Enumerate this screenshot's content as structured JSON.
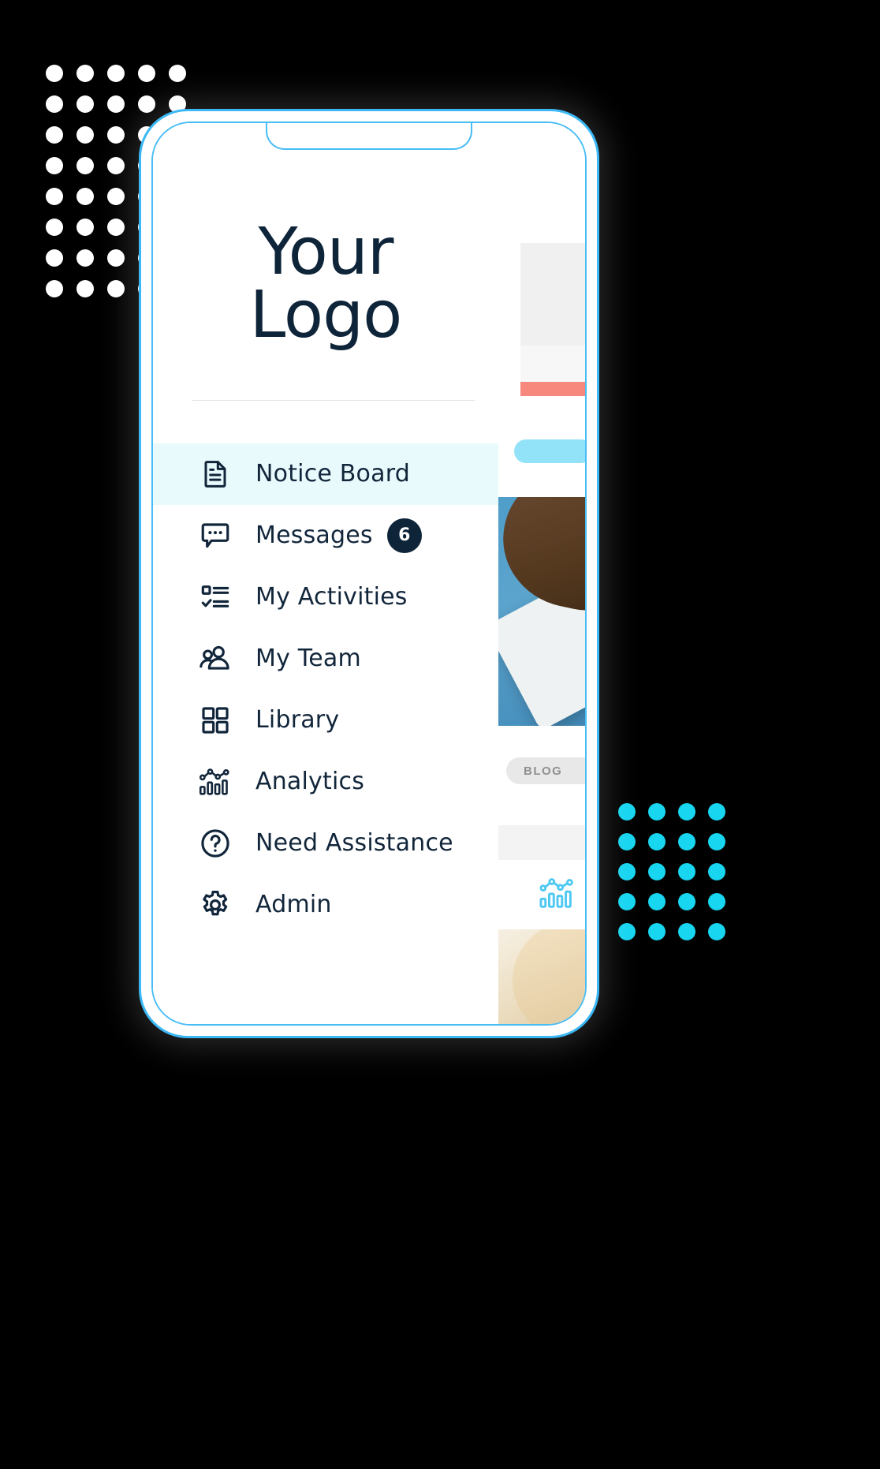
{
  "app": {
    "logo_line1": "Your",
    "logo_line2": "Logo"
  },
  "topbar": {
    "compose_icon": "compose-edit-icon"
  },
  "menu": {
    "items": [
      {
        "label": "Notice Board",
        "icon": "document-icon",
        "active": true,
        "badge": ""
      },
      {
        "label": "Messages",
        "icon": "chat-bubble-icon",
        "active": false,
        "badge": "6"
      },
      {
        "label": "My Activities",
        "icon": "checklist-icon",
        "active": false,
        "badge": ""
      },
      {
        "label": "My Team",
        "icon": "people-group-icon",
        "active": false,
        "badge": ""
      },
      {
        "label": "Library",
        "icon": "grid-squares-icon",
        "active": false,
        "badge": ""
      },
      {
        "label": "Analytics",
        "icon": "bar-chart-line-icon",
        "active": false,
        "badge": ""
      },
      {
        "label": "Need Assistance",
        "icon": "question-circle-icon",
        "active": false,
        "badge": ""
      },
      {
        "label": "Admin",
        "icon": "gear-icon",
        "active": false,
        "badge": ""
      }
    ]
  },
  "background_content": {
    "blog_badge": "BLOG",
    "analytics_widget_icon": "bar-chart-line-icon"
  },
  "decor": {
    "dots_top_left": {
      "columns": 5,
      "rows": 8,
      "color": "#ffffff"
    },
    "dots_bottom_right": {
      "columns": 4,
      "rows": 5,
      "color": "#18d5f0"
    }
  },
  "colors": {
    "background": "#000000",
    "phone_outline": "#3bb8f5",
    "text_dark": "#0e2439",
    "accent_cyan": "#18d5f0",
    "active_item_bg": "#e9fafc",
    "coral": "#f6887e",
    "pill_blue": "#92e2f8"
  }
}
